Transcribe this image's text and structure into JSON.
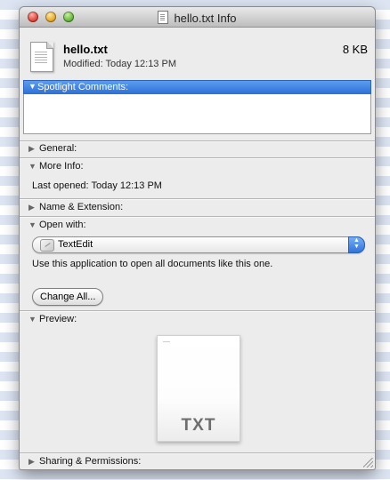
{
  "window": {
    "title": "hello.txt Info"
  },
  "file": {
    "name": "hello.txt",
    "size": "8 KB",
    "modified": "Modified: Today 12:13 PM",
    "icon": "text-document-icon"
  },
  "sections": {
    "spotlight": {
      "label": "Spotlight Comments:",
      "expanded": true,
      "value": ""
    },
    "general": {
      "label": "General:",
      "expanded": false
    },
    "more_info": {
      "label": "More Info:",
      "expanded": true,
      "last_opened": "Last opened: Today 12:13 PM"
    },
    "name_ext": {
      "label": "Name & Extension:",
      "expanded": false
    },
    "open_with": {
      "label": "Open with:",
      "expanded": true,
      "app": "TextEdit",
      "hint": "Use this application to open all documents like this one.",
      "button": "Change All..."
    },
    "preview": {
      "label": "Preview:",
      "expanded": true,
      "type_text": "TXT"
    },
    "sharing": {
      "label": "Sharing & Permissions:",
      "expanded": false
    }
  },
  "glyphs": {
    "expanded": "▼",
    "collapsed": "▶"
  },
  "colors": {
    "selection": "#2b6fd6",
    "window_bg": "#ececec"
  }
}
